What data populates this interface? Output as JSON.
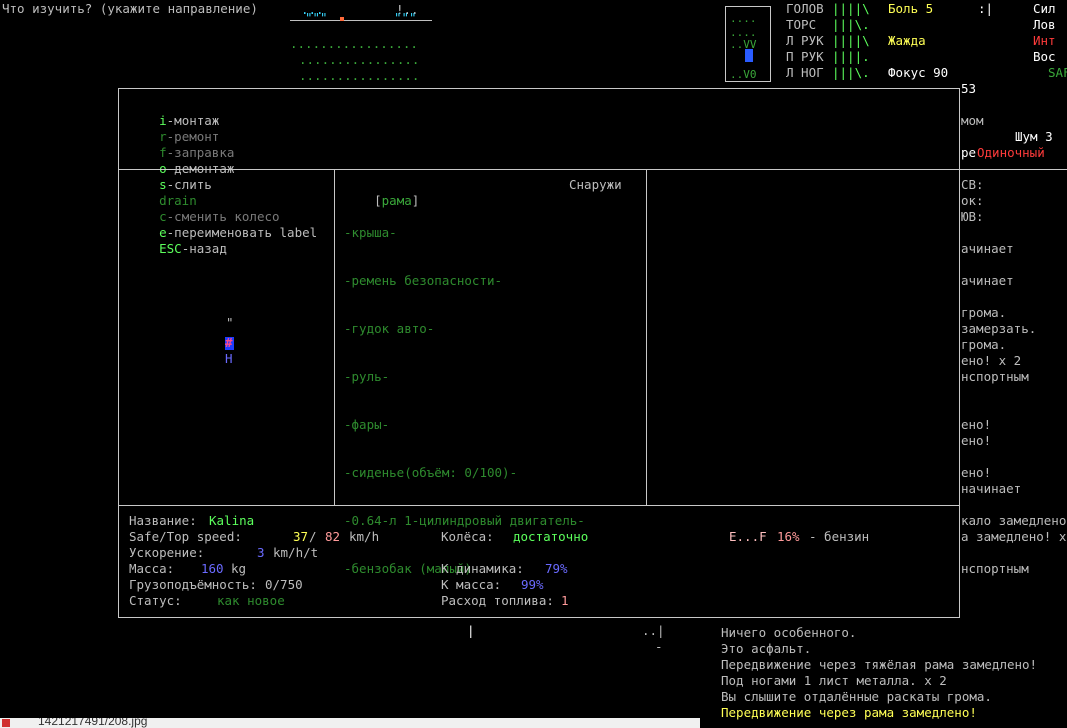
{
  "prompt": {
    "text": "Что изучить? (укажите направление)"
  },
  "minimap": {
    "rows": [
      "...",
      "\"\"\"",
      "............."
    ],
    "row2": "!..",
    "row3": "\"\"\"",
    "line3": ".................",
    "line4": "................",
    "line5": "................"
  },
  "body_status": {
    "parts": [
      {
        "name": "ГОЛОВ",
        "bar": "||||\\"
      },
      {
        "name": "ТОРС",
        "bar": "|||\\."
      },
      {
        "name": "Л РУК",
        "bar": "||||\\"
      },
      {
        "name": "П РУК",
        "bar": "||||."
      },
      {
        "name": "Л НОГ",
        "bar": "|||\\."
      }
    ],
    "effects": [
      "Боль 5",
      "",
      "Жажда",
      "",
      "Фокус 90"
    ],
    "pain_extra": ":|",
    "stats": [
      "Сил",
      "Лов",
      "Инт",
      "Вос",
      "SAF"
    ],
    "bodymap": [
      "....",
      "....",
      "..VV",
      "....",
      "..V0"
    ]
  },
  "right_panel": {
    "number": "53",
    "lines": [
      {
        "text": "мом",
        "color": "gray"
      },
      {
        "text": "Шум 3",
        "color": "white"
      },
      {
        "text": "ре",
        "color": "white"
      },
      {
        "text": "Одиночный",
        "color": "red"
      },
      {
        "text": "СВ:",
        "color": "gray"
      },
      {
        "text": "ок:",
        "color": "gray"
      },
      {
        "text": "ЮВ:",
        "color": "gray"
      },
      {
        "text": "ачинает",
        "color": "gray"
      },
      {
        "text": "ачинает",
        "color": "gray"
      },
      {
        "text": "грома.",
        "color": "gray"
      },
      {
        "text": "замерзать.",
        "color": "gray"
      },
      {
        "text": "грома.",
        "color": "gray"
      },
      {
        "text": "ено! x 2",
        "color": "gray"
      },
      {
        "text": "нспортным",
        "color": "gray"
      },
      {
        "text": "ено!",
        "color": "gray"
      },
      {
        "text": "ено!",
        "color": "gray"
      },
      {
        "text": "ено!",
        "color": "gray"
      },
      {
        "text": "начинает",
        "color": "gray"
      },
      {
        "text": "кало замедлено",
        "color": "gray"
      },
      {
        "text": "а замедлено! x",
        "color": "gray"
      },
      {
        "text": "нспортным",
        "color": "gray"
      }
    ]
  },
  "menu": [
    {
      "key": "i",
      "label": "-монтаж",
      "key_color": "lgreen",
      "label_color": "gray"
    },
    {
      "key": "r",
      "label": "-ремонт",
      "key_color": "dgreen",
      "label_color": "dim"
    },
    {
      "key": "f",
      "label": "-заправка",
      "key_color": "dgreen",
      "label_color": "dim"
    },
    {
      "key": "o",
      "label": "-демонтаж",
      "key_color": "lgreen",
      "label_color": "gray"
    },
    {
      "key": "s",
      "label": "-слить",
      "key_color": "lgreen",
      "label_color": "gray"
    },
    {
      "key": "drain",
      "label": "",
      "key_color": "dgreen",
      "label_color": "dim"
    },
    {
      "key": "c",
      "label": "-сменить колесо",
      "key_color": "dgreen",
      "label_color": "dim"
    },
    {
      "key": "e",
      "label": "-переименовать label",
      "key_color": "lgreen",
      "label_color": "gray"
    },
    {
      "key": "ESC",
      "label": "-назад",
      "key_color": "lgreen",
      "label_color": "gray"
    }
  ],
  "vehicle_map": {
    "top_glyph": "\"",
    "mid_glyph": "#",
    "bottom_glyph": "H"
  },
  "parts": {
    "selected": "рама",
    "location": "Снаружи",
    "items": [
      "-крыша-",
      "-ремень безопасности-",
      "-гудок авто-",
      "-руль-",
      "-фары-",
      "-сиденье(объём: 0/100)-",
      "-0.64-л 1-цилиндровый двигатель-",
      "-бензобак (малый)-"
    ]
  },
  "info": {
    "name_label": "Название:",
    "name_value": "Kalina",
    "speed_label": "Safe/Top speed:",
    "speed_safe": "37",
    "speed_sep": "/",
    "speed_top": "82",
    "speed_unit": "km/h",
    "accel_label": "Ускорение:",
    "accel_value": "3",
    "accel_unit": "km/h/t",
    "mass_label": "Масса:",
    "mass_value": "160",
    "mass_unit": "kg",
    "cargo_label": "Грузоподъёмность:",
    "cargo_value": "0/750",
    "status_label": "Статус:",
    "status_value": "как новое",
    "wheels_label": "Колёса:",
    "wheels_value": "достаточно",
    "dyn_label": "К динамика:",
    "dyn_value": "79%",
    "kmass_label": "К масса:",
    "kmass_value": "99%",
    "fuel_use_label": "Расход топлива:",
    "fuel_use_value": "1",
    "fuel_gauge": "E...F",
    "fuel_pct": "16%",
    "fuel_type": "- бензин"
  },
  "bottom_map": {
    "glyph1": "|",
    "glyph2": "..|",
    "glyph3": "-"
  },
  "log": [
    {
      "text": "Ничего особенного.",
      "color": "gray"
    },
    {
      "text": "Это асфальт.",
      "color": "gray"
    },
    {
      "text": "Передвижение через тяжёлая рама замедлено!",
      "color": "gray"
    },
    {
      "text": "Под ногами 1 лист металла. x 2",
      "color": "gray"
    },
    {
      "text": "Вы слышите отдалённые раскаты грома.",
      "color": "gray"
    },
    {
      "text": "Передвижение через рама замедлено!",
      "color": "yellow"
    }
  ],
  "taskbar": {
    "file": "1421217491/208.jpg"
  }
}
